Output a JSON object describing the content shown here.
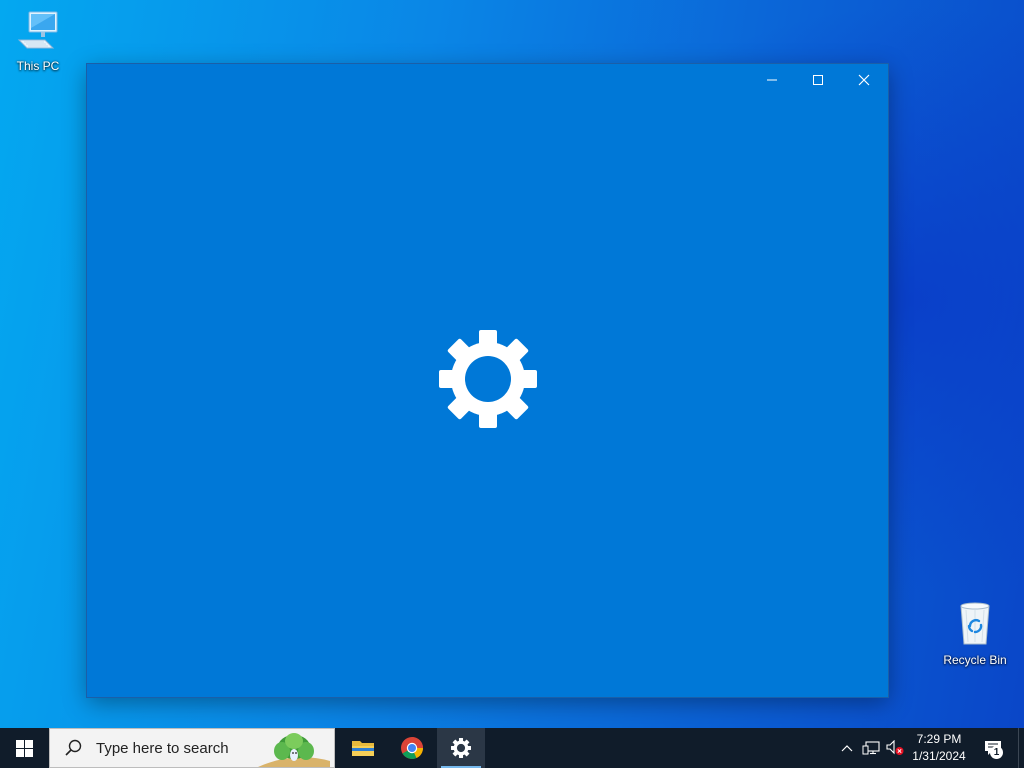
{
  "desktop": {
    "icons": [
      {
        "label": "This PC",
        "icon": "computer-icon"
      },
      {
        "label": "Recycle Bin",
        "icon": "recycle-bin-icon"
      }
    ]
  },
  "window": {
    "app": "Settings",
    "state": "loading splash",
    "splash_icon": "gear-icon",
    "background": "#0078d7",
    "caption_buttons": [
      "minimize",
      "maximize",
      "close"
    ]
  },
  "taskbar": {
    "start_icon": "windows-logo-icon",
    "search_placeholder": "Type here to search",
    "pinned": [
      {
        "name": "File Explorer",
        "icon": "folder-icon"
      },
      {
        "name": "Google Chrome",
        "icon": "chrome-icon"
      },
      {
        "name": "Settings",
        "icon": "gear-icon",
        "active": true
      }
    ],
    "tray": {
      "icons": [
        "chevron-up-icon",
        "network-icon",
        "volume-muted-icon"
      ],
      "time": "7:29 PM",
      "date": "1/31/2024",
      "notification_count": "1"
    },
    "background": "#101c2a"
  }
}
